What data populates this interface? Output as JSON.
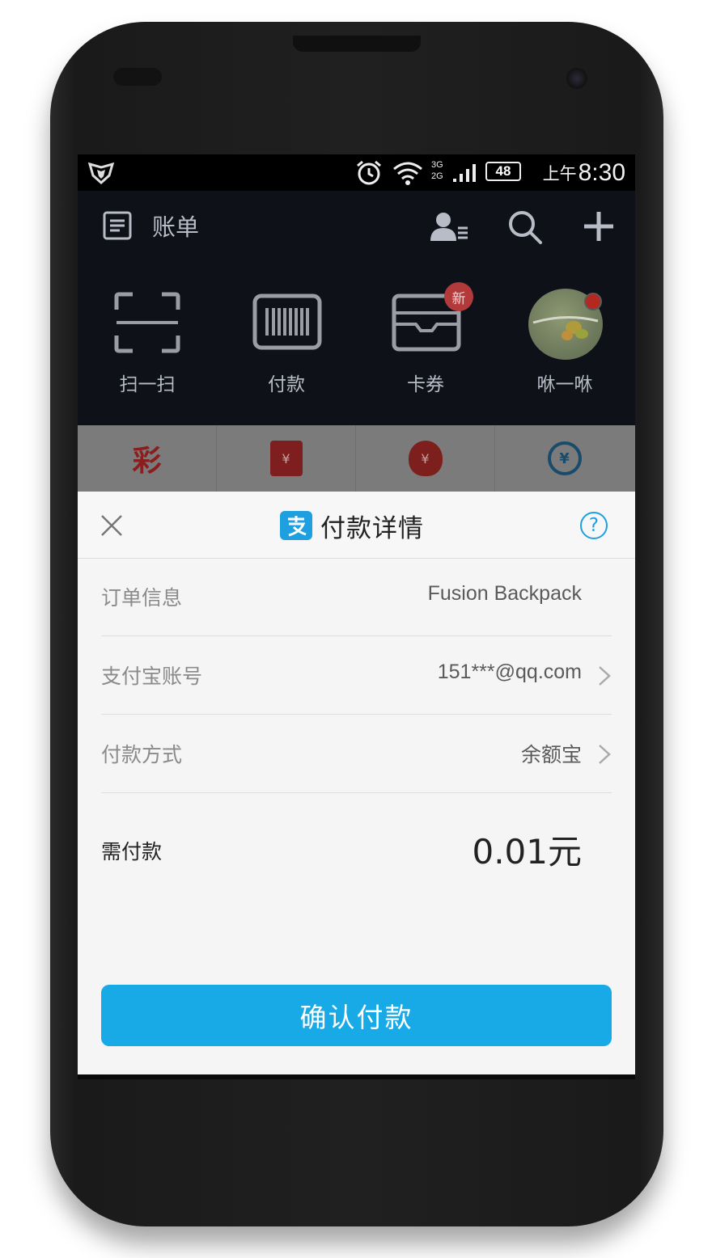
{
  "status_bar": {
    "network": "3G\n2G",
    "battery": "48",
    "ampm": "上午",
    "time": "8:30"
  },
  "header": {
    "title": "账单"
  },
  "quick_actions": [
    {
      "label": "扫一扫",
      "icon": "scan-icon"
    },
    {
      "label": "付款",
      "icon": "barcode-icon"
    },
    {
      "label": "卡券",
      "icon": "wallet-icon"
    },
    {
      "label": "咻一咻",
      "icon": "avatar-icon"
    }
  ],
  "new_badge": "新",
  "service_row": [
    {
      "icon": "lottery-icon",
      "glyph": "彩"
    },
    {
      "icon": "red-envelope-icon",
      "glyph": "¥"
    },
    {
      "icon": "money-bag-icon",
      "glyph": "¥"
    },
    {
      "icon": "transfer-icon",
      "glyph": "¥"
    }
  ],
  "payment_sheet": {
    "title": "付款详情",
    "help": "?",
    "rows": [
      {
        "key": "订单信息",
        "value": "Fusion Backpack",
        "chevron": false
      },
      {
        "key": "支付宝账号",
        "value": "151***@qq.com",
        "chevron": true
      },
      {
        "key": "付款方式",
        "value": "余额宝",
        "chevron": true
      }
    ],
    "amount_label": "需付款",
    "amount_value": "0.01元",
    "confirm_label": "确认付款"
  },
  "colors": {
    "accent": "#17aae6",
    "logo": "#1e9fe0",
    "screen_bg": "#0f1119",
    "sheet_bg": "#f5f5f5"
  }
}
